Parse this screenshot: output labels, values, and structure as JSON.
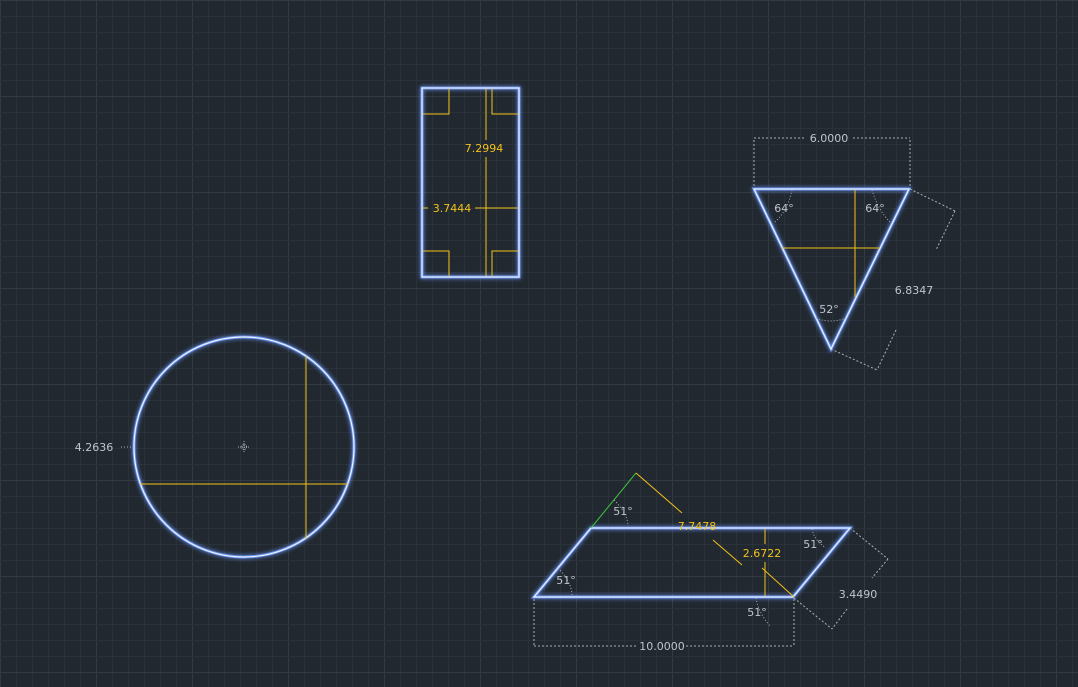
{
  "colors": {
    "background": "#212830",
    "grid_minor": "#2a313a",
    "grid_major": "#323a44",
    "shape_outline": "#ffffff",
    "shape_glow": "#3d7bff",
    "measure_yellow": "#f2c21a",
    "dimension_gray": "#aab1b8",
    "construction_green": "#3cc83c"
  },
  "rectangle": {
    "height_label": "7.2994",
    "width_label": "3.7444"
  },
  "triangle": {
    "top_width_label": "6.0000",
    "side_length_label": "6.8347",
    "angle_left_label": "64°",
    "angle_right_label": "64°",
    "angle_bottom_label": "52°"
  },
  "circle": {
    "radius_label": "4.2636"
  },
  "parallelogram": {
    "diagonal_label": "7.7478",
    "height_label": "2.6722",
    "side_label": "3.4490",
    "base_label": "10.0000",
    "angle_top_left_label": "51°",
    "angle_bottom_left_label": "51°",
    "angle_top_right_label": "51°",
    "angle_bottom_right_label": "51°"
  }
}
